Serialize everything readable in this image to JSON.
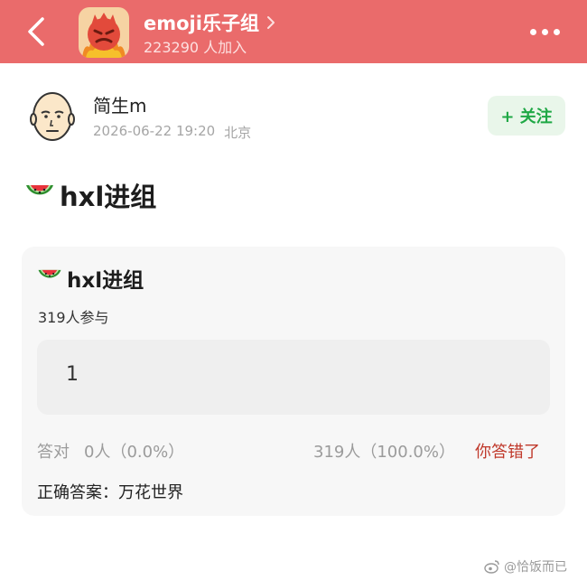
{
  "header": {
    "group_name": "emoji乐子组",
    "member_count": "223290 人加入",
    "bg_color": "#ea6b6b",
    "icons": [
      "back-arrow-icon",
      "chevron-right-icon",
      "more-dots-icon"
    ]
  },
  "post": {
    "author_name": "简生m",
    "date": "2026-06-22 19:20",
    "location": "北京",
    "follow_label": "+ 关注",
    "title": "hxl进组",
    "title_emoji": "watermelon-icon"
  },
  "quiz": {
    "title": "hxl进组",
    "participants": "319人参与",
    "option_text": "1",
    "correct_label": "答对",
    "correct_stat": "0人（0.0%）",
    "wrong_stat": "319人（100.0%）",
    "wrong_notice": "你答错了",
    "answer_line": "正确答案：万花世界"
  },
  "watermark": "@恰饭而已",
  "colors": {
    "follow_green": "#1fa845",
    "wrong_red": "#c0392b"
  }
}
